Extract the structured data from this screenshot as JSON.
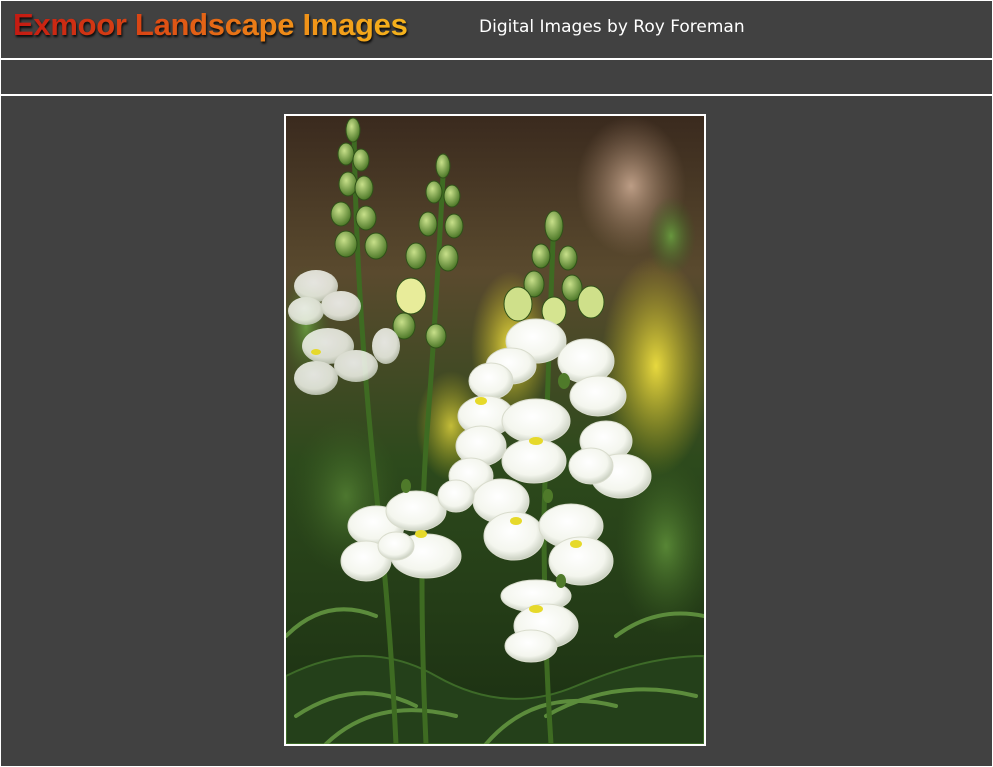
{
  "header": {
    "title": "Exmoor Landscape Images",
    "subtitle": "Digital Images by Roy Foreman"
  },
  "main": {
    "image_subject": "flower-photo",
    "accent_colors": {
      "background": "#414141",
      "rule": "#ffffff",
      "title_gradient_start": "#c41a12",
      "title_gradient_end": "#f5b41c"
    }
  }
}
